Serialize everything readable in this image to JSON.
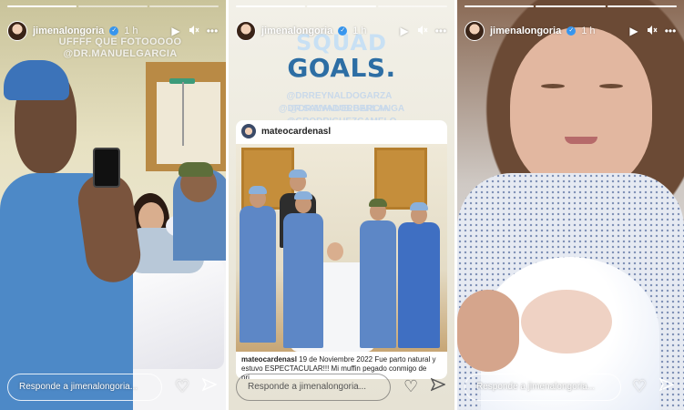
{
  "stories": [
    {
      "username": "jimenalongoria",
      "time": "1 h",
      "overlay_lines": [
        "UFFFF QUE FOTOOOOO",
        "@DR.MANUELGARCIA"
      ],
      "reply_placeholder": "Responde a jimenalongoria..."
    },
    {
      "username": "jimenalongoria",
      "time": "1 h",
      "headline_top": "SQUAD",
      "headline_bottom": "GOALS.",
      "mentions": [
        "@DRREYNALDOGARZA",
        "@DR.SALVADORBERLANGA",
        "@DR.MANUELGARCIA",
        "@GRODRIGUEZCAMELO"
      ],
      "reshare": {
        "username": "mateocardenasl",
        "caption_user": "mateocardenasl",
        "caption_text": "19 de Noviembre 2022 Fue parto natural y estuvo ESPECTACULAR!!! Mi muffin pegado conmigo de pri..."
      },
      "reply_placeholder": "Responde a jimenalongoria..."
    },
    {
      "username": "jimenalongoria",
      "time": "1 h",
      "reply_placeholder": "Responde a jimenalongoria..."
    }
  ],
  "icons": {
    "verified": "verified-badge-icon",
    "play": "play-icon",
    "mute": "mute-icon",
    "more": "more-icon",
    "heart": "heart-icon",
    "send": "send-icon"
  },
  "colors": {
    "verified": "#3897f0",
    "headline": "#2d6ea4",
    "scrubs": "#5d87c6"
  }
}
